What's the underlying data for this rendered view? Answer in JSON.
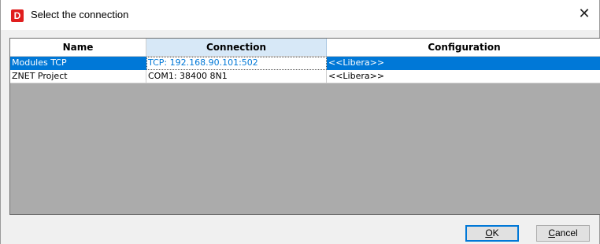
{
  "window": {
    "app_icon_letter": "D",
    "title": "Select the connection",
    "close_glyph": "✕"
  },
  "grid": {
    "columns": [
      "Name",
      "Connection",
      "Configuration"
    ],
    "rows": [
      {
        "name": "Modules TCP",
        "connection": "TCP: 192.168.90.101:502",
        "configuration": "<<Libera>>",
        "selected": true
      },
      {
        "name": "ZNET Project",
        "connection": "COM1: 38400 8N1",
        "configuration": "<<Libera>>",
        "selected": false
      }
    ]
  },
  "buttons": {
    "ok_mnemonic": "O",
    "ok_rest": "K",
    "cancel_mnemonic": "C",
    "cancel_rest": "ancel"
  },
  "colors": {
    "selection": "#0078d7",
    "grid_background": "#ababab",
    "brand_icon": "#e01e1e"
  }
}
